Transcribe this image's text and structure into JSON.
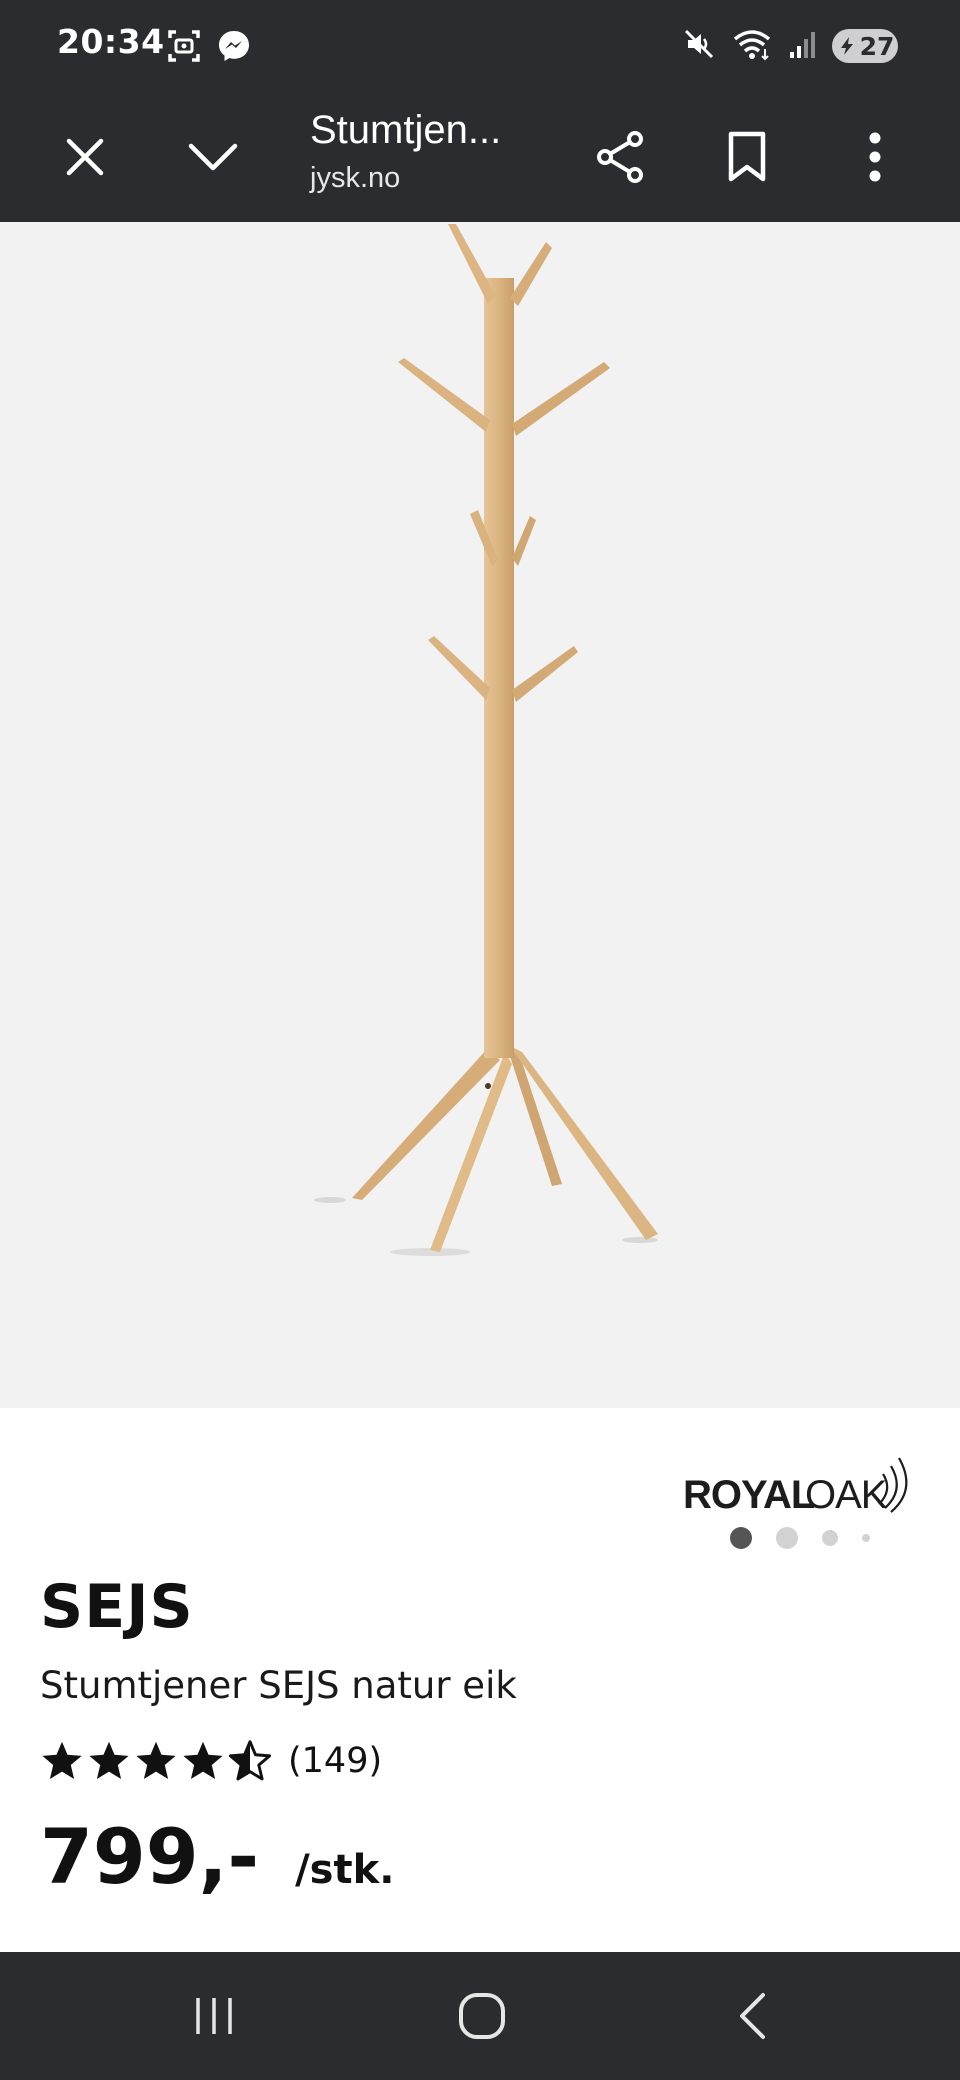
{
  "status_bar": {
    "time": "20:34",
    "battery_level": "27",
    "left_icons": [
      "screenshot-icon",
      "messenger-icon"
    ],
    "right_icons": [
      "mute-icon",
      "wifi-icon",
      "signal-icon",
      "battery-icon"
    ]
  },
  "toolbar": {
    "page_title": "Stumtjen...",
    "domain": "jysk.no",
    "icons": [
      "close-icon",
      "chevron-down-icon",
      "share-icon",
      "bookmark-icon",
      "more-vert-icon"
    ]
  },
  "product": {
    "image_subject": "wooden coat stand",
    "carousel": {
      "total": 4,
      "active": 1
    },
    "brand": "ROYAL OAK",
    "brand_mark": "TM",
    "name": "SEJS",
    "subtitle": "Stumtjener SEJS natur eik",
    "rating": 4.5,
    "rating_max": 5,
    "review_count": "(149)",
    "price": "799,-",
    "unit": "/stk."
  },
  "nav_bar": {
    "icons": [
      "recent-apps-icon",
      "home-icon",
      "back-icon"
    ]
  },
  "colors": {
    "bar": "#2b2c30",
    "image_bg": "#f2f2f2",
    "wood": "#ddb886",
    "text": "#111111"
  }
}
